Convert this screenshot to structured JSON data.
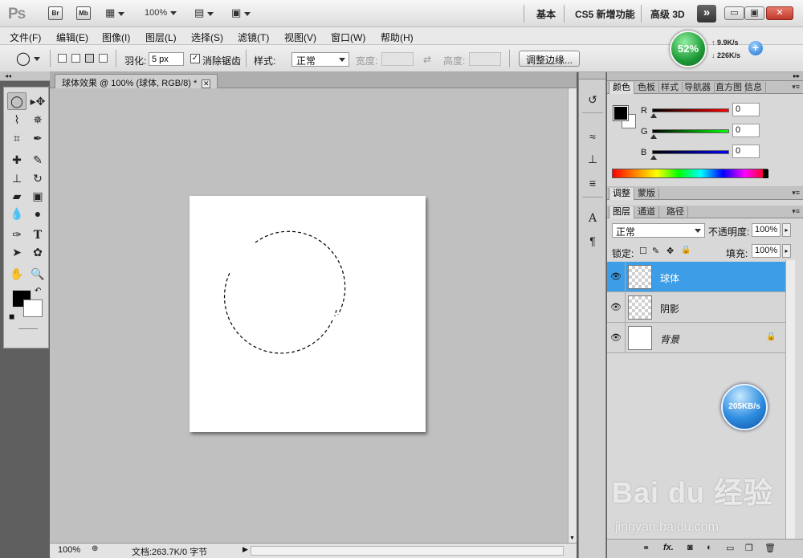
{
  "appbar": {
    "logo": "Ps",
    "bridge_label": "Br",
    "minibridge_label": "Mb",
    "zoom": "100%",
    "workspaces": [
      "基本",
      "CS5 新增功能",
      "高级 3D"
    ],
    "more_symbol": "»"
  },
  "window_controls": {
    "minimize": "▭",
    "restore": "▣",
    "close": "✕"
  },
  "menu": [
    "文件(F)",
    "编辑(E)",
    "图像(I)",
    "图层(L)",
    "选择(S)",
    "滤镜(T)",
    "视图(V)",
    "窗口(W)",
    "帮助(H)"
  ],
  "options": {
    "feather_label": "羽化:",
    "feather_value": "5 px",
    "antialias_label": "消除锯齿",
    "style_label": "样式:",
    "style_value": "正常",
    "width_label": "宽度:",
    "height_label": "高度:",
    "swap_symbol": "⇄",
    "refine_edge_label": "调整边缘..."
  },
  "net_widget": {
    "percent": "52%",
    "upload": "9.9K/s",
    "download": "226K/s",
    "up_arrow": "↑",
    "down_arrow": "↓",
    "plus": "+"
  },
  "document": {
    "tab_title": "球体效果 @ 100% (球体, RGB/8) *",
    "zoom": "100%",
    "doc_info": "文档:263.7K/0 字节"
  },
  "color_panel": {
    "tabs": [
      "颜色",
      "色板",
      "样式",
      "导航器",
      "直方图",
      "信息"
    ],
    "channels": [
      {
        "label": "R",
        "value": "0",
        "color": "#d00000"
      },
      {
        "label": "G",
        "value": "0",
        "color": "#00b000"
      },
      {
        "label": "B",
        "value": "0",
        "color": "#0000c0"
      }
    ]
  },
  "adjust_panel": {
    "tabs": [
      "调整",
      "蒙版"
    ]
  },
  "layers_panel": {
    "tabs": [
      "图层",
      "通道",
      "路径"
    ],
    "blend_mode": "正常",
    "opacity_label": "不透明度:",
    "opacity_value": "100%",
    "lock_label": "锁定:",
    "fill_label": "填充:",
    "fill_value": "100%",
    "layers": [
      {
        "name": "球体",
        "selected": true
      },
      {
        "name": "阴影",
        "selected": false
      },
      {
        "name": "背景",
        "selected": false,
        "locked": true
      }
    ],
    "footer_fx": "fx."
  },
  "speed_ball": "205KB/s",
  "watermark": {
    "brand": "Bai du 经验",
    "url": "jingyan.baidu.com"
  }
}
